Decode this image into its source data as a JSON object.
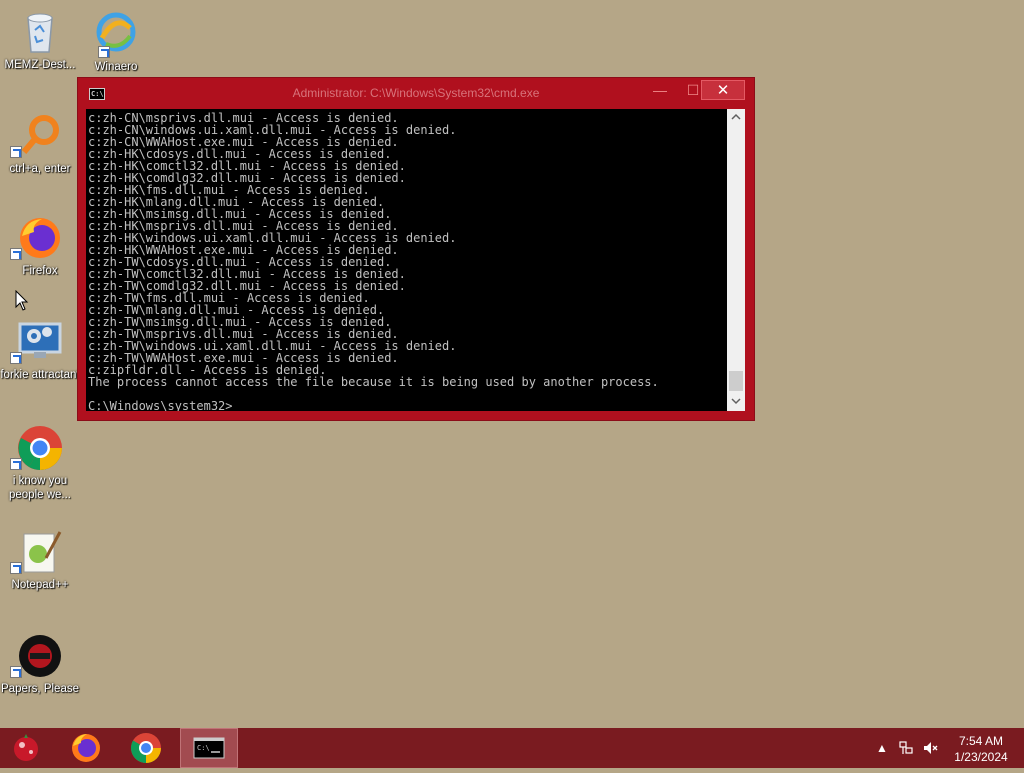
{
  "desktop": {
    "icons": [
      {
        "label": "MEMZ-Dest..."
      },
      {
        "label": "Winaero Tweaker"
      },
      {
        "label": "ctrl+a, enter"
      },
      {
        "label": "Firefox"
      },
      {
        "label": "forkie attractant"
      },
      {
        "label": "i know you people we..."
      },
      {
        "label": "Notepad++"
      },
      {
        "label": "Papers, Please"
      }
    ]
  },
  "window": {
    "title": "Administrator: C:\\Windows\\System32\\cmd.exe",
    "close_label": "✕",
    "minimize_label": "—",
    "maximize_label": "☐",
    "icon_text": "C:\\",
    "console_lines": [
      "c:zh-CN\\msprivs.dll.mui - Access is denied.",
      "c:zh-CN\\windows.ui.xaml.dll.mui - Access is denied.",
      "c:zh-CN\\WWAHost.exe.mui - Access is denied.",
      "c:zh-HK\\cdosys.dll.mui - Access is denied.",
      "c:zh-HK\\comctl32.dll.mui - Access is denied.",
      "c:zh-HK\\comdlg32.dll.mui - Access is denied.",
      "c:zh-HK\\fms.dll.mui - Access is denied.",
      "c:zh-HK\\mlang.dll.mui - Access is denied.",
      "c:zh-HK\\msimsg.dll.mui - Access is denied.",
      "c:zh-HK\\msprivs.dll.mui - Access is denied.",
      "c:zh-HK\\windows.ui.xaml.dll.mui - Access is denied.",
      "c:zh-HK\\WWAHost.exe.mui - Access is denied.",
      "c:zh-TW\\cdosys.dll.mui - Access is denied.",
      "c:zh-TW\\comctl32.dll.mui - Access is denied.",
      "c:zh-TW\\comdlg32.dll.mui - Access is denied.",
      "c:zh-TW\\fms.dll.mui - Access is denied.",
      "c:zh-TW\\mlang.dll.mui - Access is denied.",
      "c:zh-TW\\msimsg.dll.mui - Access is denied.",
      "c:zh-TW\\msprivs.dll.mui - Access is denied.",
      "c:zh-TW\\windows.ui.xaml.dll.mui - Access is denied.",
      "c:zh-TW\\WWAHost.exe.mui - Access is denied.",
      "c:zipfldr.dll - Access is denied.",
      "The process cannot access the file because it is being used by another process.",
      "",
      "C:\\Windows\\system32>"
    ]
  },
  "taskbar": {
    "buttons": [
      "start",
      "firefox",
      "chrome",
      "cmd"
    ],
    "tray": {
      "chevron": "▲"
    },
    "clock": {
      "time": "7:54 AM",
      "date": "1/23/2024"
    }
  }
}
